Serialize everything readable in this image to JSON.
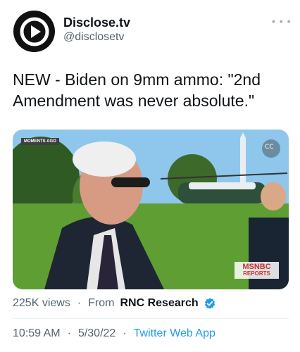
{
  "account": {
    "name": "Disclose.tv",
    "handle": "@disclosetv"
  },
  "tweet": {
    "text": "NEW - Biden on 9mm ammo: \"2nd Amendment was never absolute.\""
  },
  "media": {
    "corner_tag": "MOMENTS AGO",
    "network_logo": "MSNBC",
    "network_sub": "REPORTS"
  },
  "meta": {
    "views": "225K views",
    "from_label": "From",
    "source": "RNC Research",
    "time": "10:59 AM",
    "date": "5/30/22",
    "app": "Twitter Web App"
  },
  "icons": {
    "more": "more-icon",
    "verified": "verified-badge-icon",
    "cc": "captions-icon"
  },
  "colors": {
    "link": "#1d9bf0",
    "secondary": "#536471"
  }
}
